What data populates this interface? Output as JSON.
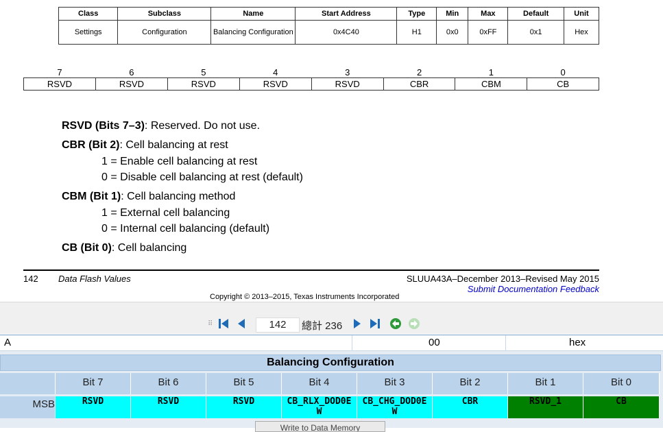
{
  "register_table": {
    "headers": [
      "Class",
      "Subclass",
      "Name",
      "Start Address",
      "Type",
      "Min",
      "Max",
      "Default",
      "Unit"
    ],
    "row": [
      "Settings",
      "Configuration",
      "Balancing Configuration",
      "0x4C40",
      "H1",
      "0x0",
      "0xFF",
      "0x1",
      "Hex"
    ]
  },
  "bit_table": {
    "numbers": [
      "7",
      "6",
      "5",
      "4",
      "3",
      "2",
      "1",
      "0"
    ],
    "names": [
      "RSVD",
      "RSVD",
      "RSVD",
      "RSVD",
      "RSVD",
      "CBR",
      "CBM",
      "CB"
    ]
  },
  "descriptions": {
    "rsvd_title": "RSVD (Bits 7–3)",
    "rsvd_text": ": Reserved. Do not use.",
    "cbr_title": "CBR (Bit 2)",
    "cbr_text": ": Cell balancing at rest",
    "cbr_opt1": "1 =  Enable cell balancing at rest",
    "cbr_opt0": "0 =  Disable cell balancing at rest (default)",
    "cbm_title": "CBM (Bit 1)",
    "cbm_text": ": Cell balancing method",
    "cbm_opt1": "1 =  External cell balancing",
    "cbm_opt0": "0 =  Internal cell balancing (default)",
    "cb_title": "CB (Bit 0)",
    "cb_text": ": Cell balancing"
  },
  "footer": {
    "page_number": "142",
    "section_title": "Data Flash Values",
    "doc_id": "SLUUA43A–December 2013–Revised May 2015",
    "feedback_link": "Submit Documentation Feedback",
    "copyright": "Copyright © 2013–2015, Texas Instruments Incorporated"
  },
  "viewer": {
    "current_page": "142",
    "total_pages": "總計 236"
  },
  "bit_grid": {
    "row_label": "A",
    "value": "00",
    "format": "hex",
    "title": "Balancing Configuration",
    "headers": [
      "Bit 7",
      "Bit 6",
      "Bit 5",
      "Bit 4",
      "Bit 3",
      "Bit 2",
      "Bit 1",
      "Bit 0"
    ],
    "msb_label": "MSB",
    "cells": [
      {
        "label": "RSVD",
        "color": "#00ffff"
      },
      {
        "label": "RSVD",
        "color": "#00ffff"
      },
      {
        "label": "RSVD",
        "color": "#00ffff"
      },
      {
        "label": "CB_RLX_DOD0E\nW",
        "color": "#00ffff"
      },
      {
        "label": "CB_CHG_DOD0E\nW",
        "color": "#00ffff"
      },
      {
        "label": "CBR",
        "color": "#00ffff"
      },
      {
        "label": "RSVD_1",
        "color": "#008000"
      },
      {
        "label": "CB",
        "color": "#008000"
      }
    ],
    "write_button": "Write to Data Memory"
  },
  "colors": {
    "grid_header": "#bcd3ec",
    "link": "#0000cc",
    "nav_icon": "#1e6bb8",
    "nav_green": "#2e9b3a"
  }
}
